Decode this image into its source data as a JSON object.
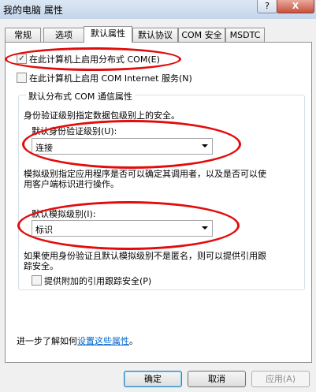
{
  "window": {
    "title": "我的电脑 属性",
    "help_label": "?",
    "close_label": "X"
  },
  "tabs": [
    {
      "label": "常规"
    },
    {
      "label": "选项"
    },
    {
      "label": "默认属性"
    },
    {
      "label": "默认协议"
    },
    {
      "label": "COM 安全"
    },
    {
      "label": "MSDTC"
    }
  ],
  "active_tab": "默认属性",
  "dcom": {
    "checked": true,
    "check_mark": "✓",
    "label": "在此计算机上启用分布式 COM(E)"
  },
  "com_internet": {
    "checked": false,
    "label": "在此计算机上启用 COM Internet 服务(N)"
  },
  "group": {
    "title": "默认分布式 COM 通信属性",
    "auth_desc": "身份验证级别指定数据包级别上的安全。",
    "auth_label": "默认身份验证级别(U):",
    "auth_value": "连接",
    "imp_desc_line1": "模拟级别指定应用程序是否可以确定其调用者，以及是否可以使",
    "imp_desc_line2": "用客户端标识进行操作。",
    "imp_label": "默认模拟级别(I):",
    "imp_value": "标识",
    "ref_desc_line1": "如果使用身份验证且默认模拟级别不是匿名，则可以提供引用跟",
    "ref_desc_line2": "踪安全。",
    "ref_checkbox_label": "提供附加的引用跟踪安全(P)",
    "ref_checked": false
  },
  "footer": {
    "prefix": "进一步了解如何",
    "link": "设置这些属性",
    "suffix": "。"
  },
  "buttons": {
    "ok": "确定",
    "cancel": "取消",
    "apply": "应用(A)"
  },
  "annotation_color": "#e10d0d"
}
